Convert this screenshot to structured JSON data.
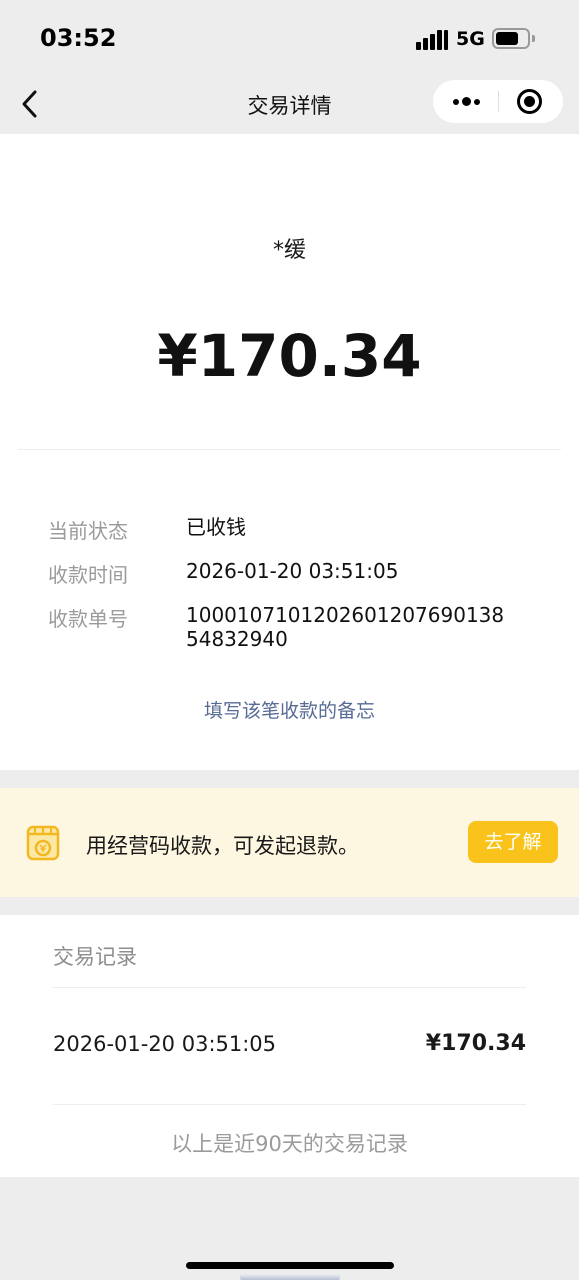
{
  "status_bar": {
    "time": "03:52",
    "network": "5G",
    "icons": [
      "signal-icon",
      "battery-icon"
    ]
  },
  "nav": {
    "title": "交易详情",
    "back_icon": "chevron-left-icon",
    "more_icon": "more-dots-icon",
    "close_icon": "record-circle-icon"
  },
  "transaction": {
    "payer": "*缓",
    "amount": "¥170.34",
    "details": [
      {
        "label": "当前状态",
        "value": "已收钱"
      },
      {
        "label": "收款时间",
        "value": "2026-01-20 03:51:05"
      },
      {
        "label": "收款单号",
        "value": "1000107101202601207690138 54832940"
      }
    ],
    "memo_link": "填写该笔收款的备忘"
  },
  "banner": {
    "icon": "merchant-qr-icon",
    "text": "用经营码收款，可发起退款。",
    "button_label": "去了解",
    "button_color": "#f9c31b"
  },
  "records": {
    "title": "交易记录",
    "items": [
      {
        "date": "2026-01-20 03:51:05",
        "amount": "¥170.34"
      }
    ],
    "footer": "以上是近90天的交易记录"
  },
  "colors": {
    "page_bg": "#ededed",
    "link": "#576b95",
    "banner_bg": "#fdf7e2"
  }
}
